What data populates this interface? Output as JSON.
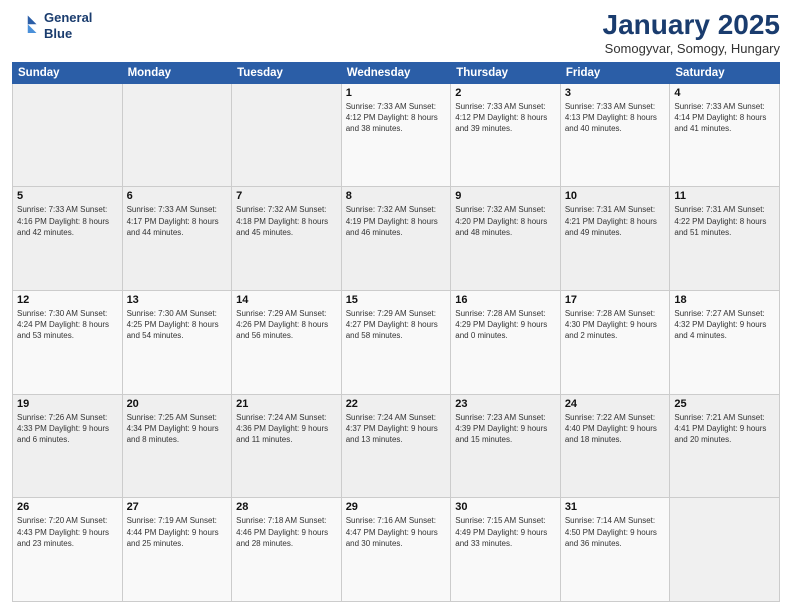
{
  "logo": {
    "line1": "General",
    "line2": "Blue"
  },
  "title": "January 2025",
  "subtitle": "Somogyvar, Somogy, Hungary",
  "headers": [
    "Sunday",
    "Monday",
    "Tuesday",
    "Wednesday",
    "Thursday",
    "Friday",
    "Saturday"
  ],
  "weeks": [
    [
      {
        "day": "",
        "info": ""
      },
      {
        "day": "",
        "info": ""
      },
      {
        "day": "",
        "info": ""
      },
      {
        "day": "1",
        "info": "Sunrise: 7:33 AM\nSunset: 4:12 PM\nDaylight: 8 hours\nand 38 minutes."
      },
      {
        "day": "2",
        "info": "Sunrise: 7:33 AM\nSunset: 4:12 PM\nDaylight: 8 hours\nand 39 minutes."
      },
      {
        "day": "3",
        "info": "Sunrise: 7:33 AM\nSunset: 4:13 PM\nDaylight: 8 hours\nand 40 minutes."
      },
      {
        "day": "4",
        "info": "Sunrise: 7:33 AM\nSunset: 4:14 PM\nDaylight: 8 hours\nand 41 minutes."
      }
    ],
    [
      {
        "day": "5",
        "info": "Sunrise: 7:33 AM\nSunset: 4:16 PM\nDaylight: 8 hours\nand 42 minutes."
      },
      {
        "day": "6",
        "info": "Sunrise: 7:33 AM\nSunset: 4:17 PM\nDaylight: 8 hours\nand 44 minutes."
      },
      {
        "day": "7",
        "info": "Sunrise: 7:32 AM\nSunset: 4:18 PM\nDaylight: 8 hours\nand 45 minutes."
      },
      {
        "day": "8",
        "info": "Sunrise: 7:32 AM\nSunset: 4:19 PM\nDaylight: 8 hours\nand 46 minutes."
      },
      {
        "day": "9",
        "info": "Sunrise: 7:32 AM\nSunset: 4:20 PM\nDaylight: 8 hours\nand 48 minutes."
      },
      {
        "day": "10",
        "info": "Sunrise: 7:31 AM\nSunset: 4:21 PM\nDaylight: 8 hours\nand 49 minutes."
      },
      {
        "day": "11",
        "info": "Sunrise: 7:31 AM\nSunset: 4:22 PM\nDaylight: 8 hours\nand 51 minutes."
      }
    ],
    [
      {
        "day": "12",
        "info": "Sunrise: 7:30 AM\nSunset: 4:24 PM\nDaylight: 8 hours\nand 53 minutes."
      },
      {
        "day": "13",
        "info": "Sunrise: 7:30 AM\nSunset: 4:25 PM\nDaylight: 8 hours\nand 54 minutes."
      },
      {
        "day": "14",
        "info": "Sunrise: 7:29 AM\nSunset: 4:26 PM\nDaylight: 8 hours\nand 56 minutes."
      },
      {
        "day": "15",
        "info": "Sunrise: 7:29 AM\nSunset: 4:27 PM\nDaylight: 8 hours\nand 58 minutes."
      },
      {
        "day": "16",
        "info": "Sunrise: 7:28 AM\nSunset: 4:29 PM\nDaylight: 9 hours\nand 0 minutes."
      },
      {
        "day": "17",
        "info": "Sunrise: 7:28 AM\nSunset: 4:30 PM\nDaylight: 9 hours\nand 2 minutes."
      },
      {
        "day": "18",
        "info": "Sunrise: 7:27 AM\nSunset: 4:32 PM\nDaylight: 9 hours\nand 4 minutes."
      }
    ],
    [
      {
        "day": "19",
        "info": "Sunrise: 7:26 AM\nSunset: 4:33 PM\nDaylight: 9 hours\nand 6 minutes."
      },
      {
        "day": "20",
        "info": "Sunrise: 7:25 AM\nSunset: 4:34 PM\nDaylight: 9 hours\nand 8 minutes."
      },
      {
        "day": "21",
        "info": "Sunrise: 7:24 AM\nSunset: 4:36 PM\nDaylight: 9 hours\nand 11 minutes."
      },
      {
        "day": "22",
        "info": "Sunrise: 7:24 AM\nSunset: 4:37 PM\nDaylight: 9 hours\nand 13 minutes."
      },
      {
        "day": "23",
        "info": "Sunrise: 7:23 AM\nSunset: 4:39 PM\nDaylight: 9 hours\nand 15 minutes."
      },
      {
        "day": "24",
        "info": "Sunrise: 7:22 AM\nSunset: 4:40 PM\nDaylight: 9 hours\nand 18 minutes."
      },
      {
        "day": "25",
        "info": "Sunrise: 7:21 AM\nSunset: 4:41 PM\nDaylight: 9 hours\nand 20 minutes."
      }
    ],
    [
      {
        "day": "26",
        "info": "Sunrise: 7:20 AM\nSunset: 4:43 PM\nDaylight: 9 hours\nand 23 minutes."
      },
      {
        "day": "27",
        "info": "Sunrise: 7:19 AM\nSunset: 4:44 PM\nDaylight: 9 hours\nand 25 minutes."
      },
      {
        "day": "28",
        "info": "Sunrise: 7:18 AM\nSunset: 4:46 PM\nDaylight: 9 hours\nand 28 minutes."
      },
      {
        "day": "29",
        "info": "Sunrise: 7:16 AM\nSunset: 4:47 PM\nDaylight: 9 hours\nand 30 minutes."
      },
      {
        "day": "30",
        "info": "Sunrise: 7:15 AM\nSunset: 4:49 PM\nDaylight: 9 hours\nand 33 minutes."
      },
      {
        "day": "31",
        "info": "Sunrise: 7:14 AM\nSunset: 4:50 PM\nDaylight: 9 hours\nand 36 minutes."
      },
      {
        "day": "",
        "info": ""
      }
    ]
  ]
}
